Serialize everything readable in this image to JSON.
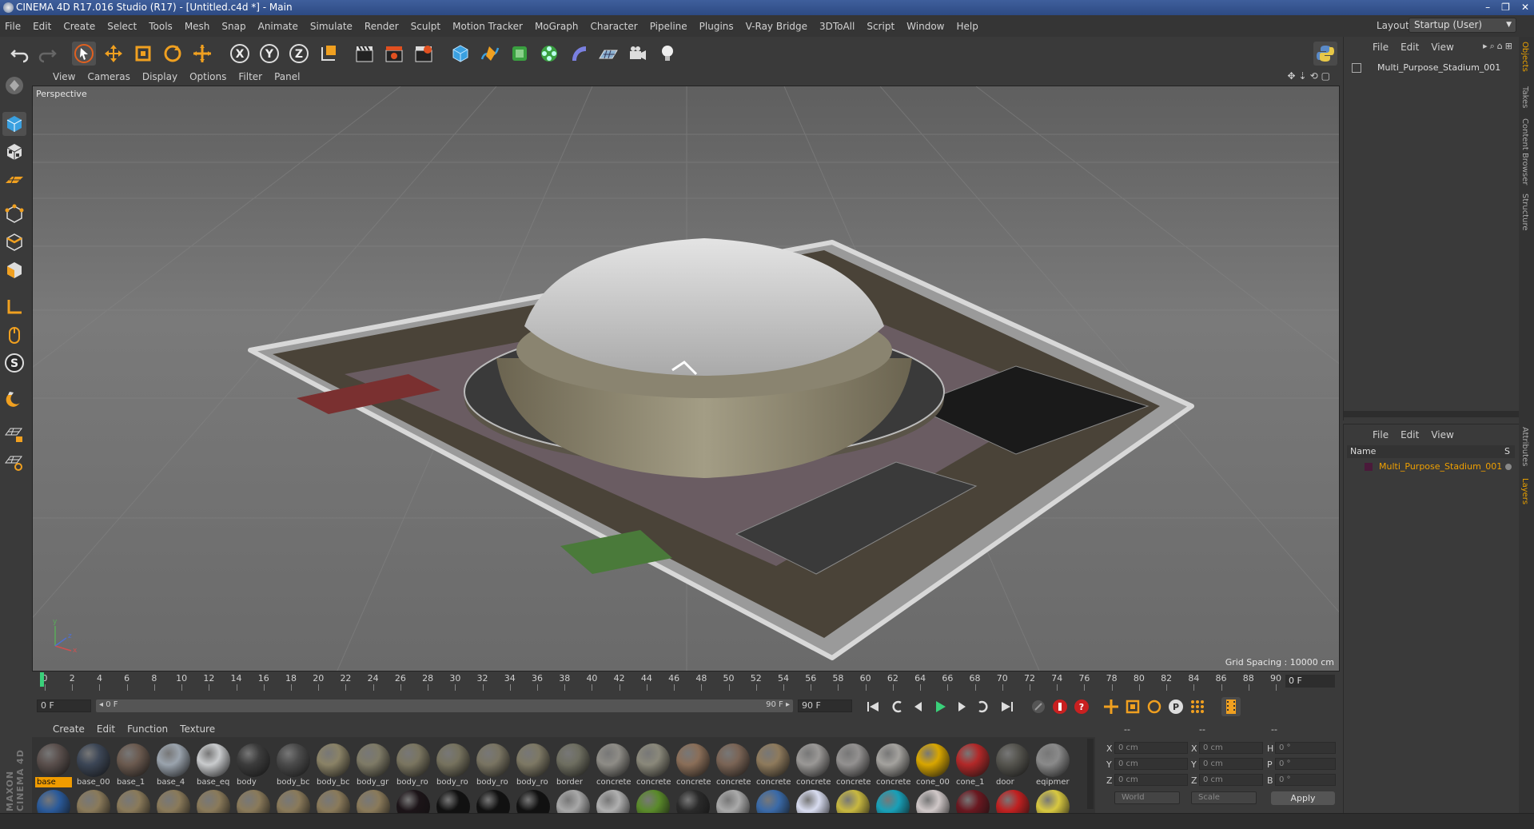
{
  "window": {
    "title": "CINEMA 4D R17.016 Studio (R17) - [Untitled.c4d *] - Main",
    "controls": [
      "–",
      "❐",
      "✕"
    ]
  },
  "menubar": {
    "items": [
      "File",
      "Edit",
      "Create",
      "Select",
      "Tools",
      "Mesh",
      "Snap",
      "Animate",
      "Simulate",
      "Render",
      "Sculpt",
      "Motion Tracker",
      "MoGraph",
      "Character",
      "Pipeline",
      "Plugins",
      "V-Ray Bridge",
      "3DToAll",
      "Script",
      "Window",
      "Help"
    ],
    "layout_label": "Layout:",
    "layout_value": "Startup (User)"
  },
  "viewport": {
    "menu": [
      "View",
      "Cameras",
      "Display",
      "Options",
      "Filter",
      "Panel"
    ],
    "camera_label": "Perspective",
    "grid_spacing": "Grid Spacing : 10000 cm"
  },
  "timeline": {
    "ticks": [
      "0",
      "2",
      "4",
      "6",
      "8",
      "10",
      "12",
      "14",
      "16",
      "18",
      "20",
      "22",
      "24",
      "26",
      "28",
      "30",
      "32",
      "34",
      "36",
      "38",
      "40",
      "42",
      "44",
      "46",
      "48",
      "50",
      "52",
      "54",
      "56",
      "58",
      "60",
      "62",
      "64",
      "66",
      "68",
      "70",
      "72",
      "74",
      "76",
      "78",
      "80",
      "82",
      "84",
      "86",
      "88",
      "90"
    ],
    "current_frame": "0 F"
  },
  "playback": {
    "start_field": "0 F",
    "range_start": "◂ 0 F",
    "range_end": "90 F ▸",
    "end_field": "90 F"
  },
  "materials": {
    "menu": [
      "Create",
      "Edit",
      "Function",
      "Texture"
    ],
    "row1": [
      {
        "label": "base",
        "color": "#5a4f4c"
      },
      {
        "label": "base_00",
        "color": "#3c4656"
      },
      {
        "label": "base_1",
        "color": "#6b5a4f"
      },
      {
        "label": "base_4",
        "color": "#9aa3ad"
      },
      {
        "label": "base_eq",
        "color": "#c9cbcd"
      },
      {
        "label": "body",
        "color": "#3c3c3c"
      },
      {
        "label": "body_bc",
        "color": "#4a4a4a"
      },
      {
        "label": "body_bc",
        "color": "#8a8266"
      },
      {
        "label": "body_gr",
        "color": "#7e7a66"
      },
      {
        "label": "body_ro",
        "color": "#7a7560"
      },
      {
        "label": "body_ro",
        "color": "#76725e"
      },
      {
        "label": "body_ro",
        "color": "#797462"
      },
      {
        "label": "body_ro",
        "color": "#7d7864"
      },
      {
        "label": "border",
        "color": "#6e6e60"
      },
      {
        "label": "concrete",
        "color": "#8e8c86"
      },
      {
        "label": "concrete",
        "color": "#8a887a"
      },
      {
        "label": "concrete",
        "color": "#8a6e58"
      },
      {
        "label": "concrete",
        "color": "#7a6455"
      },
      {
        "label": "concrete",
        "color": "#8e7a5c"
      },
      {
        "label": "concrete",
        "color": "#9a9896"
      },
      {
        "label": "concrete",
        "color": "#939190"
      },
      {
        "label": "concrete",
        "color": "#a4a29e"
      },
      {
        "label": "cone_00",
        "color": "#d8a600"
      },
      {
        "label": "cone_1",
        "color": "#b22828"
      },
      {
        "label": "door",
        "color": "#55544e"
      },
      {
        "label": "eqipmer",
        "color": "#8a8a8a"
      }
    ],
    "row2": [
      {
        "label": "",
        "color": "#2a5a9a"
      },
      {
        "label": "",
        "color": "#8a7a5a"
      },
      {
        "label": "",
        "color": "#8a7a5a"
      },
      {
        "label": "",
        "color": "#8a7a5a"
      },
      {
        "label": "",
        "color": "#8a7a5a"
      },
      {
        "label": "",
        "color": "#8a7a5a"
      },
      {
        "label": "",
        "color": "#8a7a5a"
      },
      {
        "label": "",
        "color": "#8a7a5a"
      },
      {
        "label": "",
        "color": "#8a7a5a"
      },
      {
        "label": "",
        "color": "#1c1418"
      },
      {
        "label": "",
        "color": "#111111"
      },
      {
        "label": "",
        "color": "#111111"
      },
      {
        "label": "",
        "color": "#111111"
      },
      {
        "label": "",
        "color": "#a8a8a8"
      },
      {
        "label": "",
        "color": "#b0b0b0"
      },
      {
        "label": "",
        "color": "#5a8a2a"
      },
      {
        "label": "",
        "color": "#2a2a2a"
      },
      {
        "label": "",
        "color": "#aaaaaa"
      },
      {
        "label": "",
        "color": "#3a6aa8"
      },
      {
        "label": "",
        "color": "#d8dcf0"
      },
      {
        "label": "",
        "color": "#c8b840"
      },
      {
        "label": "",
        "color": "#18a0b8"
      },
      {
        "label": "",
        "color": "#d0c8c8"
      },
      {
        "label": "",
        "color": "#6a1820"
      },
      {
        "label": "",
        "color": "#c02020"
      },
      {
        "label": "",
        "color": "#d8c840"
      }
    ]
  },
  "coords": {
    "headers": [
      "--",
      "--",
      "--"
    ],
    "rows": [
      {
        "a": "X",
        "av": "0 cm",
        "b": "X",
        "bv": "0 cm",
        "c": "H",
        "cv": "0 °"
      },
      {
        "a": "Y",
        "av": "0 cm",
        "b": "Y",
        "bv": "0 cm",
        "c": "P",
        "cv": "0 °"
      },
      {
        "a": "Z",
        "av": "0 cm",
        "b": "Z",
        "bv": "0 cm",
        "c": "B",
        "cv": "0 °"
      }
    ],
    "space": "World",
    "mode": "Scale",
    "apply": "Apply"
  },
  "objects": {
    "menu": [
      "File",
      "Edit",
      "View"
    ],
    "item": "Multi_Purpose_Stadium_001"
  },
  "layers": {
    "menu": [
      "File",
      "Edit",
      "View"
    ],
    "col_name": "Name",
    "col_s": "S",
    "item": "Multi_Purpose_Stadium_001"
  },
  "sidetabs": [
    "Objects",
    "Takes",
    "Content Browser",
    "Structure",
    "Attributes",
    "Layers"
  ],
  "brand": "MAXON CINEMA 4D",
  "colors": {
    "accent": "#f09b00",
    "viewport_bg": "#6f6f6f"
  }
}
